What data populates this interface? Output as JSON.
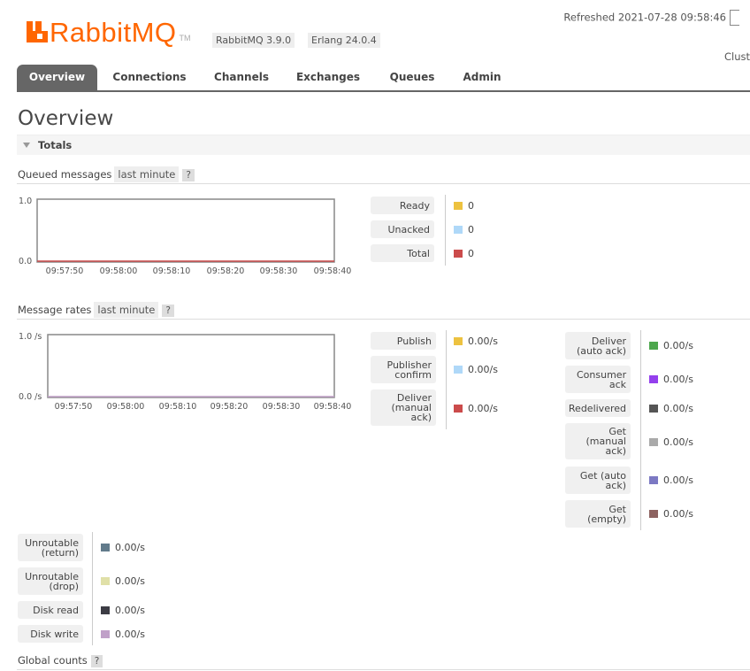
{
  "header": {
    "logo_text": "RabbitMQ",
    "logo_tm": "TM",
    "version_badge": "RabbitMQ 3.9.0",
    "erlang_badge": "Erlang 24.0.4",
    "refreshed": "Refreshed 2021-07-28 09:58:46",
    "cluster_label": "Clust"
  },
  "tabs": [
    "Overview",
    "Connections",
    "Channels",
    "Exchanges",
    "Queues",
    "Admin"
  ],
  "page_title": "Overview",
  "totals": {
    "section_label": "Totals",
    "queued": {
      "label": "Queued messages",
      "range": "last minute",
      "help": "?",
      "chart": {
        "y_top": "1.0",
        "y_bottom": "0.0",
        "x_ticks": [
          "09:57:50",
          "09:58:00",
          "09:58:10",
          "09:58:20",
          "09:58:30",
          "09:58:40"
        ]
      },
      "legend": [
        {
          "label": "Ready",
          "value": "0",
          "color": "#edc240"
        },
        {
          "label": "Unacked",
          "value": "0",
          "color": "#afd8f8"
        },
        {
          "label": "Total",
          "value": "0",
          "color": "#cb4b4b"
        }
      ]
    },
    "rates": {
      "label": "Message rates",
      "range": "last minute",
      "help": "?",
      "chart": {
        "y_top": "1.0 /s",
        "y_bottom": "0.0 /s",
        "x_ticks": [
          "09:57:50",
          "09:58:00",
          "09:58:10",
          "09:58:20",
          "09:58:30",
          "09:58:40"
        ]
      },
      "col1": [
        {
          "label": "Publish",
          "value": "0.00/s",
          "color": "#edc240"
        },
        {
          "label": "Publisher confirm",
          "value": "0.00/s",
          "color": "#afd8f8"
        },
        {
          "label": "Deliver (manual ack)",
          "value": "0.00/s",
          "color": "#cb4b4b"
        }
      ],
      "col2": [
        {
          "label": "Deliver (auto ack)",
          "value": "0.00/s",
          "color": "#4da74d"
        },
        {
          "label": "Consumer ack",
          "value": "0.00/s",
          "color": "#9440ed"
        },
        {
          "label": "Redelivered",
          "value": "0.00/s",
          "color": "#555555"
        },
        {
          "label": "Get (manual ack)",
          "value": "0.00/s",
          "color": "#aaaaaa"
        },
        {
          "label": "Get (auto ack)",
          "value": "0.00/s",
          "color": "#7c79c3"
        },
        {
          "label": "Get (empty)",
          "value": "0.00/s",
          "color": "#8d6260"
        }
      ],
      "col3": [
        {
          "label": "Unroutable (return)",
          "value": "0.00/s",
          "color": "#627b8b"
        },
        {
          "label": "Unroutable (drop)",
          "value": "0.00/s",
          "color": "#e0e0a8"
        },
        {
          "label": "Disk read",
          "value": "0.00/s",
          "color": "#3c3c44"
        },
        {
          "label": "Disk write",
          "value": "0.00/s",
          "color": "#c0a0c8"
        }
      ]
    },
    "global_counts": {
      "label": "Global counts",
      "help": "?"
    }
  }
}
